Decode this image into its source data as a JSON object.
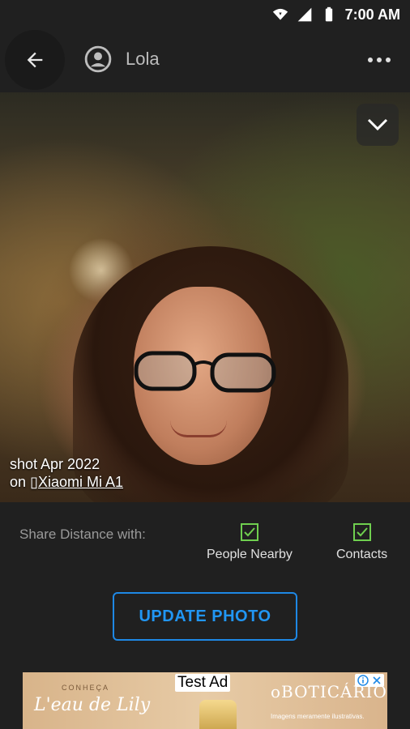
{
  "status_bar": {
    "time": "7:00 AM"
  },
  "app_bar": {
    "title": "Lola"
  },
  "photo": {
    "credit_line1": "shot Apr 2022",
    "credit_line2_prefix": "on ",
    "device_name": "Xiaomi Mi A1"
  },
  "share": {
    "label": "Share Distance with:",
    "options": [
      {
        "label": "People Nearby",
        "checked": true
      },
      {
        "label": "Contacts",
        "checked": true
      }
    ]
  },
  "update_button": {
    "label": "UPDATE PHOTO"
  },
  "ad": {
    "badge": "Test Ad",
    "small_brand": "CONHEÇA",
    "script_text": "L'eau de Lily",
    "logo_text": "oBOTICÁRIO",
    "note": "Imagens meramente ilustrativas."
  },
  "colors": {
    "accent_blue": "#1e88e5",
    "check_green": "#6fcf4f",
    "background": "#202020"
  }
}
